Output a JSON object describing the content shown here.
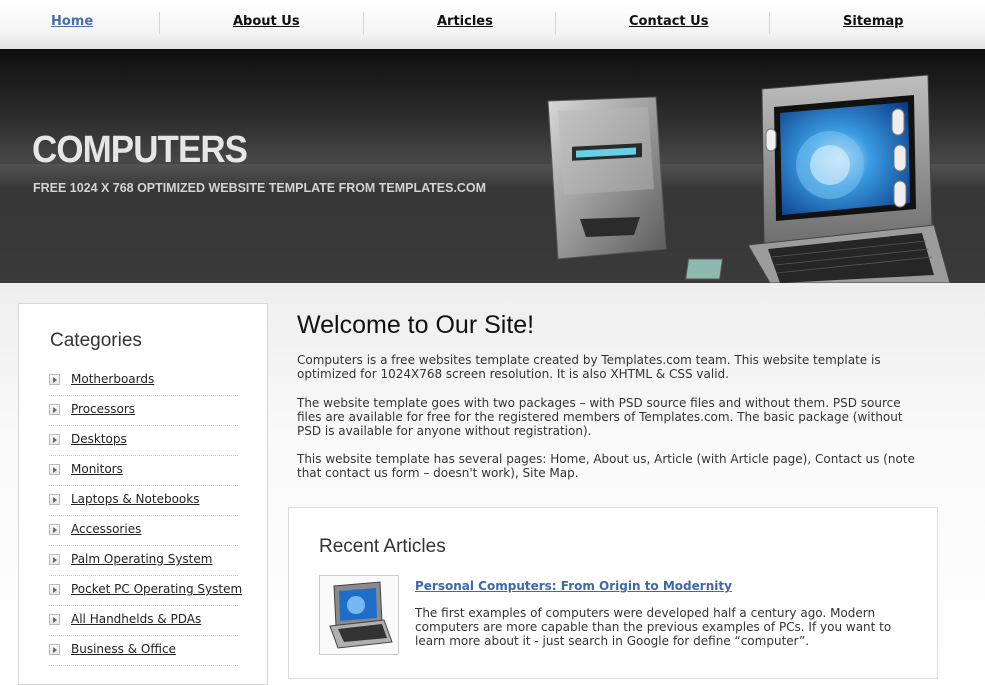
{
  "nav": {
    "items": [
      {
        "label": "Home",
        "active": true
      },
      {
        "label": "About Us"
      },
      {
        "label": "Articles"
      },
      {
        "label": "Contact Us"
      },
      {
        "label": "Sitemap"
      }
    ]
  },
  "banner": {
    "title": "COMPUTERS",
    "subtitle": "FREE 1024 X 768 OPTIMIZED WEBSITE TEMPLATE FROM TEMPLATES.COM"
  },
  "sidebar": {
    "heading": "Categories",
    "items": [
      "Motherboards",
      "Processors",
      "Desktops",
      "Monitors",
      "Laptops & Notebooks",
      "Accessories",
      "Palm Operating System",
      "Pocket PC Operating System",
      "All Handhelds & PDAs",
      "Business & Office"
    ]
  },
  "main": {
    "title": "Welcome to Our Site!",
    "paragraphs": [
      "Computers is a free websites template created by Templates.com team. This website template is optimized for 1024X768 screen resolution. It is also XHTML & CSS valid.",
      "The website template goes with two packages – with PSD source files and without them. PSD source files are available for free for the registered members of Templates.com. The basic package (without PSD is available for anyone without registration).",
      "This website template has several pages: Home, About us, Article (with Article page), Contact us (note that contact us form – doesn't work), Site Map."
    ]
  },
  "recent": {
    "heading": "Recent Articles",
    "article": {
      "title": "Personal Computers: From Origin to Modernity",
      "text": "The first examples of computers were developed half a century ago. Modern computers are more capable than the previous examples of PCs. If you want to learn more about it - just search in Google for define “computer”."
    }
  },
  "colors": {
    "link_active": "#4a6fa6",
    "article_title": "#3f68a8",
    "banner_dark": "#2d2d2d"
  }
}
